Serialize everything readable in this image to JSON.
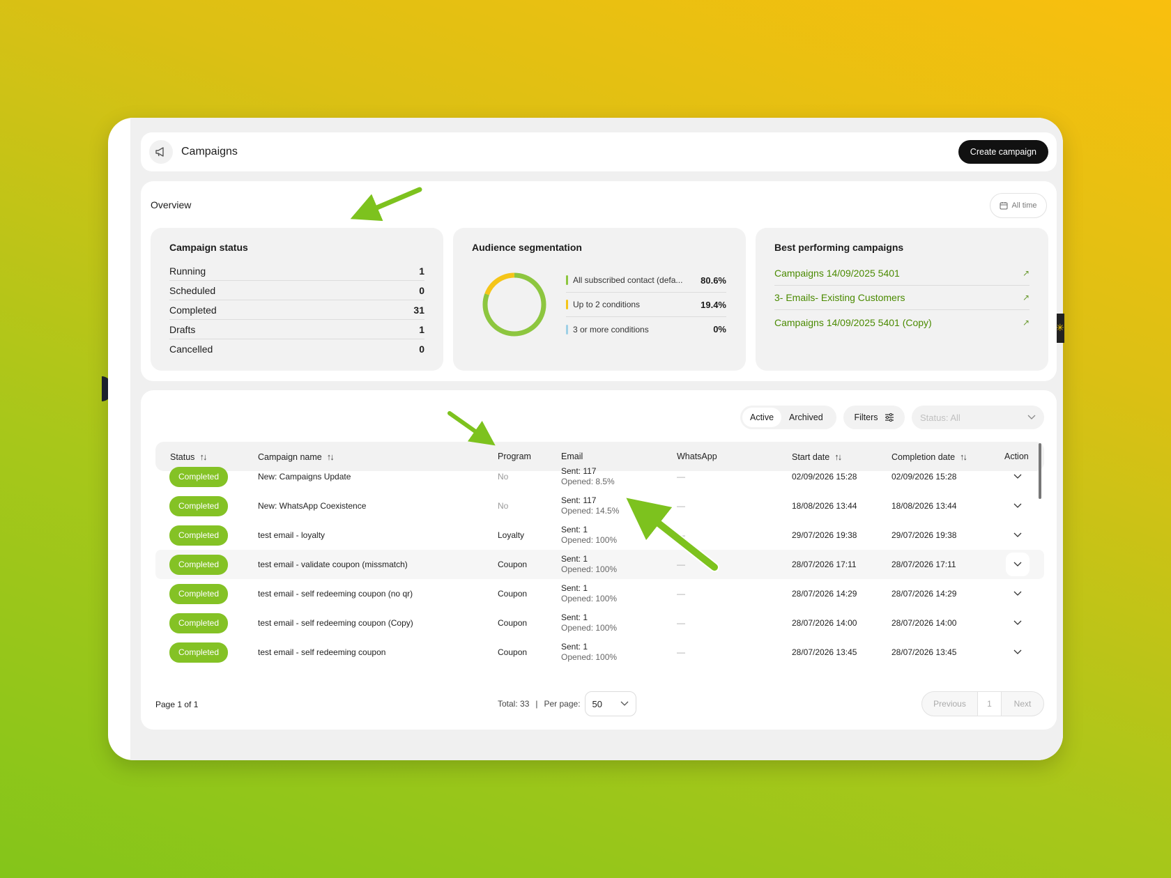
{
  "header": {
    "title": "Campaigns",
    "icon": "megaphone-icon",
    "create_label": "Create campaign"
  },
  "overview": {
    "title": "Overview",
    "range_label": "All time",
    "campaign_status": {
      "title": "Campaign status",
      "rows": [
        {
          "label": "Running",
          "value": "1"
        },
        {
          "label": "Scheduled",
          "value": "0"
        },
        {
          "label": "Completed",
          "value": "31"
        },
        {
          "label": "Drafts",
          "value": "1"
        },
        {
          "label": "Cancelled",
          "value": "0"
        }
      ]
    },
    "audience": {
      "title": "Audience segmentation",
      "segments": [
        {
          "label": "All subscribed contact (defa...",
          "value": "80.6%",
          "fraction": 0.806,
          "color": "#8dc63f"
        },
        {
          "label": "Up to 2 conditions",
          "value": "19.4%",
          "fraction": 0.194,
          "color": "#f5c518"
        },
        {
          "label": "3 or more conditions",
          "value": "0%",
          "fraction": 0.0,
          "color": "#9ed0e6"
        }
      ]
    },
    "best": {
      "title": "Best performing campaigns",
      "items": [
        {
          "label": "Campaigns 14/09/2025 5401"
        },
        {
          "label": "3- Emails- Existing Customers"
        },
        {
          "label": "Campaigns 14/09/2025 5401 (Copy)"
        }
      ]
    }
  },
  "table": {
    "tabs": {
      "active": "Active",
      "archived": "Archived"
    },
    "filters_label": "Filters",
    "status_placeholder": "Status: All",
    "columns": {
      "status": "Status",
      "name": "Campaign name",
      "program": "Program",
      "email": "Email",
      "whatsapp": "WhatsApp",
      "start": "Start date",
      "completion": "Completion date",
      "action": "Action"
    },
    "rows": [
      {
        "status": "Completed",
        "name": "New: Campaigns Update",
        "program": "No",
        "sent": "Sent: 117",
        "opened": "Opened: 8.5%",
        "whatsapp": "—",
        "start": "02/09/2026 15:28",
        "completion": "02/09/2026 15:28"
      },
      {
        "status": "Completed",
        "name": "New: WhatsApp Coexistence",
        "program": "No",
        "sent": "Sent: 117",
        "opened": "Opened: 14.5%",
        "whatsapp": "—",
        "start": "18/08/2026 13:44",
        "completion": "18/08/2026 13:44"
      },
      {
        "status": "Completed",
        "name": "test email - loyalty",
        "program": "Loyalty",
        "sent": "Sent: 1",
        "opened": "Opened: 100%",
        "whatsapp": "—",
        "start": "29/07/2026 19:38",
        "completion": "29/07/2026 19:38"
      },
      {
        "status": "Completed",
        "name": "test email - validate coupon (missmatch)",
        "program": "Coupon",
        "sent": "Sent: 1",
        "opened": "Opened: 100%",
        "whatsapp": "—",
        "start": "28/07/2026 17:11",
        "completion": "28/07/2026 17:11"
      },
      {
        "status": "Completed",
        "name": "test email - self redeeming coupon (no qr)",
        "program": "Coupon",
        "sent": "Sent: 1",
        "opened": "Opened: 100%",
        "whatsapp": "—",
        "start": "28/07/2026 14:29",
        "completion": "28/07/2026 14:29"
      },
      {
        "status": "Completed",
        "name": "test email - self redeeming coupon (Copy)",
        "program": "Coupon",
        "sent": "Sent: 1",
        "opened": "Opened: 100%",
        "whatsapp": "—",
        "start": "28/07/2026 14:00",
        "completion": "28/07/2026 14:00"
      },
      {
        "status": "Completed",
        "name": "test email - self redeeming coupon",
        "program": "Coupon",
        "sent": "Sent: 1",
        "opened": "Opened: 100%",
        "whatsapp": "—",
        "start": "28/07/2026 13:45",
        "completion": "28/07/2026 13:45"
      }
    ],
    "pagination": {
      "page_label": "Page 1 of 1",
      "total_label": "Total: 33",
      "separator": "|",
      "per_page_label": "Per page:",
      "per_page_value": "50",
      "previous": "Previous",
      "current": "1",
      "next": "Next"
    }
  },
  "colors": {
    "accent_green": "#84c225",
    "link_green": "#4a8a00",
    "annotation_arrow": "#7dc21e"
  }
}
